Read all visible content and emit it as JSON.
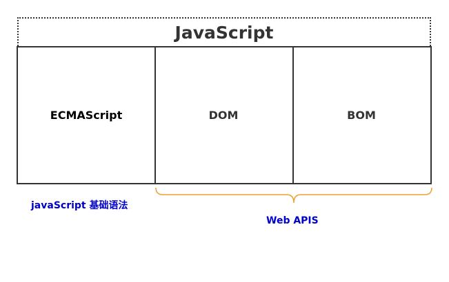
{
  "diagram": {
    "title": "JavaScript",
    "blocks": [
      {
        "label": "ECMAScript"
      },
      {
        "label": "DOM"
      },
      {
        "label": "BOM"
      }
    ],
    "annotations": {
      "basic_syntax": "javaScript 基础语法",
      "web_apis": "Web APIS"
    },
    "colors": {
      "border": "#333333",
      "brace": "#f0a030",
      "annotation_text": "#0000cc"
    }
  }
}
